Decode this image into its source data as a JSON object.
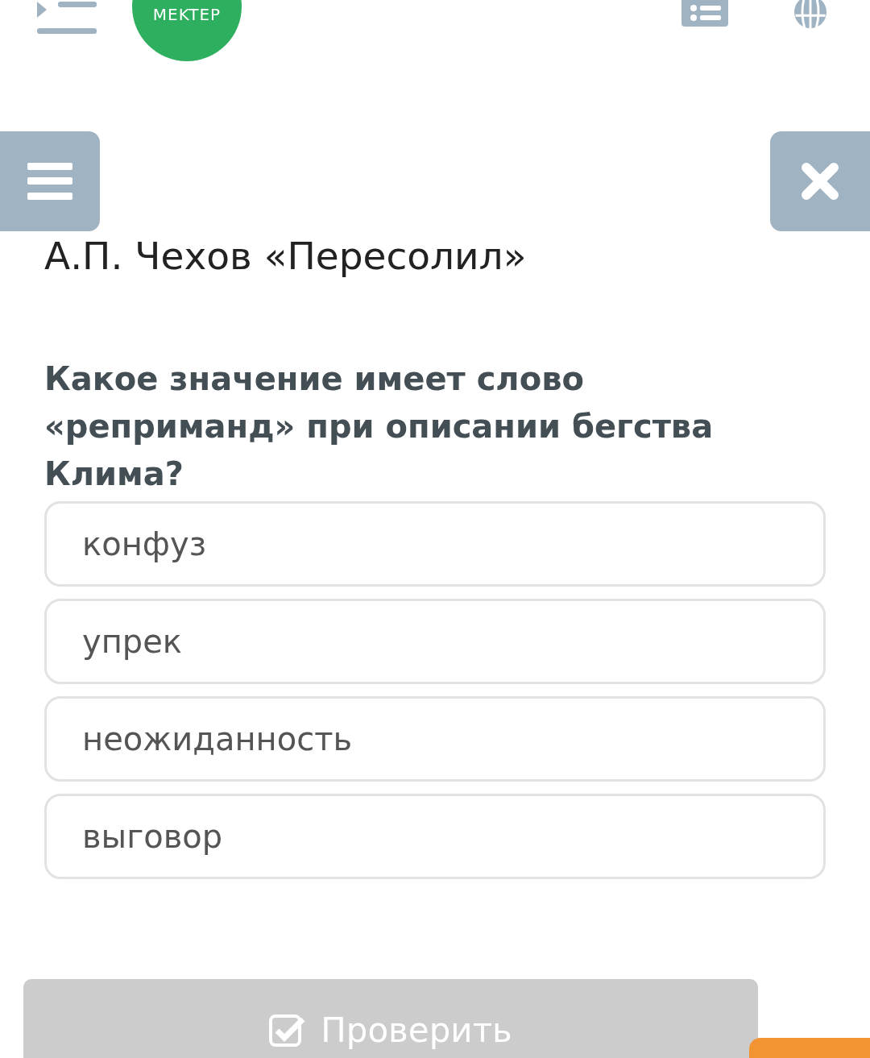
{
  "header": {
    "logo_text": "MEKTEP"
  },
  "title": "А.П. Чехов «Пересолил»",
  "question": "Какое значение имеет слово «реприманд» при описании бегства Клима?",
  "options": [
    {
      "label": "конфуз",
      "selected": false
    },
    {
      "label": "упрек",
      "selected": false
    },
    {
      "label": "неожиданность",
      "selected": false
    },
    {
      "label": "выговор",
      "selected": false
    }
  ],
  "check_button": {
    "label": "Проверить",
    "disabled": true
  }
}
